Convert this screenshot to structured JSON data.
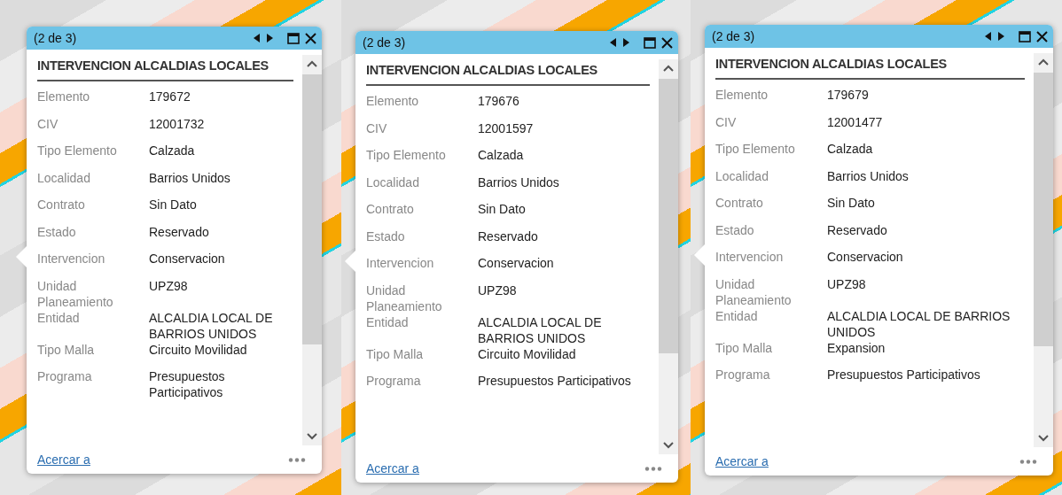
{
  "panels": [
    {
      "popup": {
        "pager": "(2 de 3)",
        "title": "INTERVENCION ALCALDIAS LOCALES",
        "fields": [
          {
            "label": "Elemento",
            "value": "179672"
          },
          {
            "label": "CIV",
            "value": "12001732"
          },
          {
            "label": "Tipo Elemento",
            "value": "Calzada"
          },
          {
            "label": "Localidad",
            "value": "Barrios Unidos"
          },
          {
            "label": "Contrato",
            "value": "Sin Dato"
          },
          {
            "label": "Estado",
            "value": "Reservado"
          },
          {
            "label": "Intervencion",
            "value": "Conservacion"
          },
          {
            "label": "Unidad Planeamiento",
            "value": "UPZ98"
          },
          {
            "label": "Entidad",
            "value": "ALCALDIA LOCAL DE BARRIOS UNIDOS"
          },
          {
            "label": "Tipo Malla",
            "value": "Circuito Movilidad"
          },
          {
            "label": "Programa",
            "value": "Presupuestos Participativos"
          }
        ],
        "link": "Acercar a"
      }
    },
    {
      "popup": {
        "pager": "(2 de 3)",
        "title": "INTERVENCION ALCALDIAS LOCALES",
        "fields": [
          {
            "label": "Elemento",
            "value": "179676"
          },
          {
            "label": "CIV",
            "value": "12001597"
          },
          {
            "label": "Tipo Elemento",
            "value": "Calzada"
          },
          {
            "label": "Localidad",
            "value": "Barrios Unidos"
          },
          {
            "label": "Contrato",
            "value": "Sin Dato"
          },
          {
            "label": "Estado",
            "value": "Reservado"
          },
          {
            "label": "Intervencion",
            "value": "Conservacion"
          },
          {
            "label": "Unidad Planeamiento",
            "value": "UPZ98"
          },
          {
            "label": "Entidad",
            "value": "ALCALDIA LOCAL DE BARRIOS UNIDOS"
          },
          {
            "label": "Tipo Malla",
            "value": "Circuito Movilidad"
          },
          {
            "label": "Programa",
            "value": "Presupuestos Participativos"
          }
        ],
        "link": "Acercar a"
      }
    },
    {
      "popup": {
        "pager": "(2 de 3)",
        "title": "INTERVENCION ALCALDIAS LOCALES",
        "fields": [
          {
            "label": "Elemento",
            "value": "179679"
          },
          {
            "label": "CIV",
            "value": "12001477"
          },
          {
            "label": "Tipo Elemento",
            "value": "Calzada"
          },
          {
            "label": "Localidad",
            "value": "Barrios Unidos"
          },
          {
            "label": "Contrato",
            "value": "Sin Dato"
          },
          {
            "label": "Estado",
            "value": "Reservado"
          },
          {
            "label": "Intervencion",
            "value": "Conservacion"
          },
          {
            "label": "Unidad Planeamiento",
            "value": "UPZ98"
          },
          {
            "label": "Entidad",
            "value": "ALCALDIA LOCAL DE BARRIOS UNIDOS"
          },
          {
            "label": "Tipo Malla",
            "value": "Expansion"
          },
          {
            "label": "Programa",
            "value": "Presupuestos Participativos"
          }
        ],
        "link": "Acercar a"
      }
    }
  ]
}
